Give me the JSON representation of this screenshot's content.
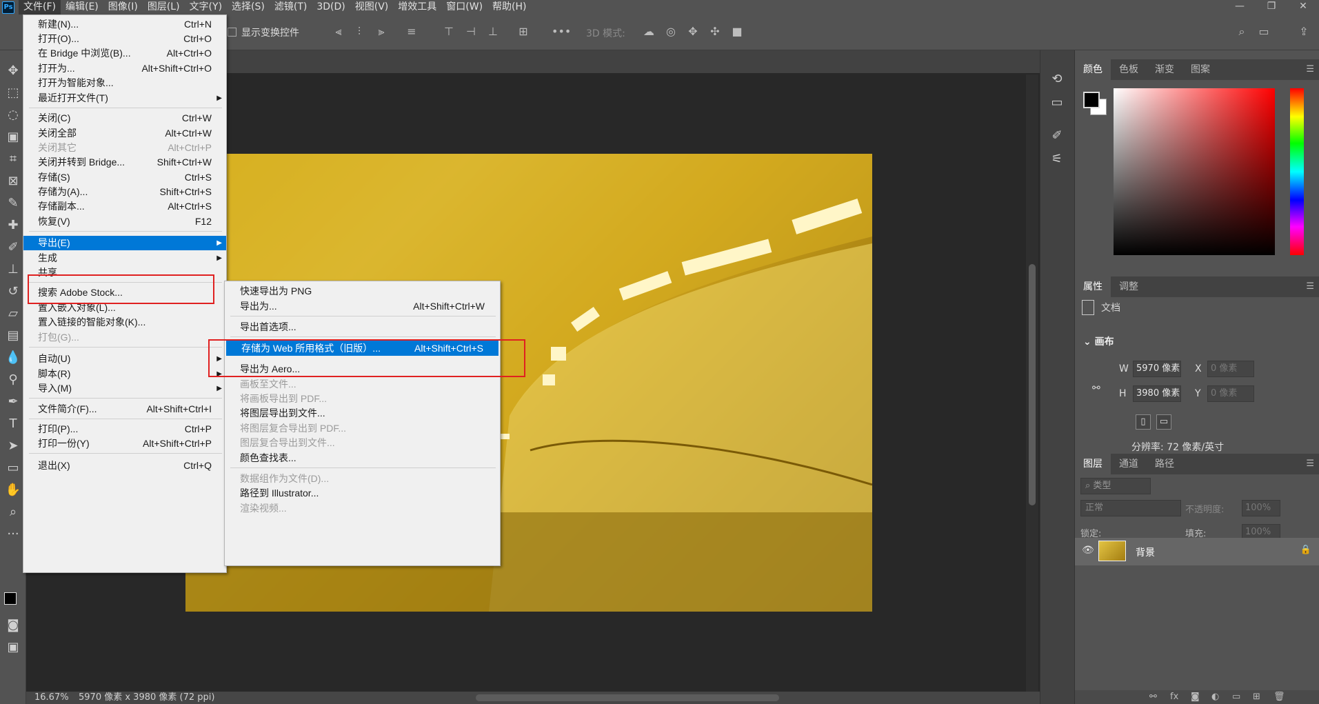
{
  "menubar": {
    "logo": "Ps",
    "items": [
      "文件(F)",
      "编辑(E)",
      "图像(I)",
      "图层(L)",
      "文字(Y)",
      "选择(S)",
      "滤镜(T)",
      "3D(D)",
      "视图(V)",
      "增效工具",
      "窗口(W)",
      "帮助(H)"
    ],
    "window_controls": [
      "—",
      "❐",
      "✕"
    ]
  },
  "options_bar": {
    "show_transform_label": "显示变换控件",
    "mode_3d_label": "3D 模式:"
  },
  "file_menu": {
    "items": [
      {
        "label": "新建(N)...",
        "shortcut": "Ctrl+N"
      },
      {
        "label": "打开(O)...",
        "shortcut": "Ctrl+O"
      },
      {
        "label": "在 Bridge 中浏览(B)...",
        "shortcut": "Alt+Ctrl+O"
      },
      {
        "label": "打开为...",
        "shortcut": "Alt+Shift+Ctrl+O"
      },
      {
        "label": "打开为智能对象...",
        "shortcut": ""
      },
      {
        "label": "最近打开文件(T)",
        "shortcut": ""
      },
      {
        "label": "关闭(C)",
        "shortcut": "Ctrl+W"
      },
      {
        "label": "关闭全部",
        "shortcut": "Alt+Ctrl+W"
      },
      {
        "label": "关闭其它",
        "shortcut": "Alt+Ctrl+P"
      },
      {
        "label": "关闭并转到 Bridge...",
        "shortcut": "Shift+Ctrl+W"
      },
      {
        "label": "存储(S)",
        "shortcut": "Ctrl+S"
      },
      {
        "label": "存储为(A)...",
        "shortcut": "Shift+Ctrl+S"
      },
      {
        "label": "存储副本...",
        "shortcut": "Alt+Ctrl+S"
      },
      {
        "label": "恢复(V)",
        "shortcut": "F12"
      },
      {
        "label": "导出(E)",
        "shortcut": ""
      },
      {
        "label": "生成",
        "shortcut": ""
      },
      {
        "label": "共享...",
        "shortcut": ""
      },
      {
        "label": "搜索 Adobe Stock...",
        "shortcut": ""
      },
      {
        "label": "置入嵌入对象(L)...",
        "shortcut": ""
      },
      {
        "label": "置入链接的智能对象(K)...",
        "shortcut": ""
      },
      {
        "label": "打包(G)...",
        "shortcut": ""
      },
      {
        "label": "自动(U)",
        "shortcut": ""
      },
      {
        "label": "脚本(R)",
        "shortcut": ""
      },
      {
        "label": "导入(M)",
        "shortcut": ""
      },
      {
        "label": "文件简介(F)...",
        "shortcut": "Alt+Shift+Ctrl+I"
      },
      {
        "label": "打印(P)...",
        "shortcut": "Ctrl+P"
      },
      {
        "label": "打印一份(Y)",
        "shortcut": "Alt+Shift+Ctrl+P"
      },
      {
        "label": "退出(X)",
        "shortcut": "Ctrl+Q"
      }
    ]
  },
  "export_submenu": {
    "items": [
      {
        "label": "快速导出为 PNG",
        "shortcut": ""
      },
      {
        "label": "导出为...",
        "shortcut": "Alt+Shift+Ctrl+W"
      },
      {
        "label": "导出首选项...",
        "shortcut": ""
      },
      {
        "label": "存储为 Web 所用格式（旧版）...",
        "shortcut": "Alt+Shift+Ctrl+S"
      },
      {
        "label": "导出为 Aero...",
        "shortcut": ""
      },
      {
        "label": "画板至文件...",
        "shortcut": ""
      },
      {
        "label": "将画板导出到 PDF...",
        "shortcut": ""
      },
      {
        "label": "将图层导出到文件...",
        "shortcut": ""
      },
      {
        "label": "将图层复合导出到 PDF...",
        "shortcut": ""
      },
      {
        "label": "图层复合导出到文件...",
        "shortcut": ""
      },
      {
        "label": "颜色查找表...",
        "shortcut": ""
      },
      {
        "label": "数据组作为文件(D)...",
        "shortcut": ""
      },
      {
        "label": "路径到 Illustrator...",
        "shortcut": ""
      },
      {
        "label": "渲染视频...",
        "shortcut": ""
      }
    ]
  },
  "color_panel": {
    "tabs": [
      "颜色",
      "色板",
      "渐变",
      "图案"
    ]
  },
  "properties_panel": {
    "tabs": [
      "属性",
      "调整"
    ],
    "doc_label": "文档",
    "canvas_title": "画布",
    "w_label": "W",
    "w_value": "5970 像素",
    "h_label": "H",
    "h_value": "3980 像素",
    "x_label": "X",
    "x_placeholder": "0 像素",
    "y_label": "Y",
    "y_placeholder": "0 像素",
    "resolution": "分辨率: 72 像素/英寸"
  },
  "layers_panel": {
    "tabs": [
      "图层",
      "通道",
      "路径"
    ],
    "search_placeholder": "类型",
    "blend_mode": "正常",
    "opacity_label": "不透明度:",
    "opacity_value": "100%",
    "lock_label": "锁定:",
    "fill_label": "填充:",
    "fill_value": "100%",
    "layer_name": "背景"
  },
  "statusbar": {
    "zoom": "16.67%",
    "info": "5970 像素 x 3980 像素 (72 ppi)"
  }
}
